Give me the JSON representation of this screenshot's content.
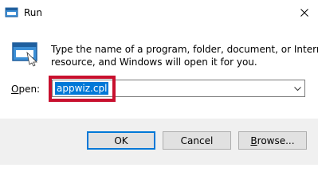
{
  "window": {
    "title": "Run",
    "app_icon": "run-icon",
    "close_icon": "close-icon"
  },
  "dialog": {
    "description_line1": "Type the name of a program, folder, document, or Internet",
    "description_line2": "resource, and Windows will open it for you.",
    "open_label_mnemonic": "O",
    "open_label_rest": "pen:",
    "open_value": "appwiz.cpl",
    "dropdown_icon": "chevron-down-icon"
  },
  "buttons": {
    "ok": "OK",
    "cancel": "Cancel",
    "browse_mnemonic": "B",
    "browse_rest": "rowse..."
  },
  "colors": {
    "selection": "#0078d7",
    "highlight_annotation": "#c8102e",
    "footer_bg": "#f0f0f0"
  }
}
